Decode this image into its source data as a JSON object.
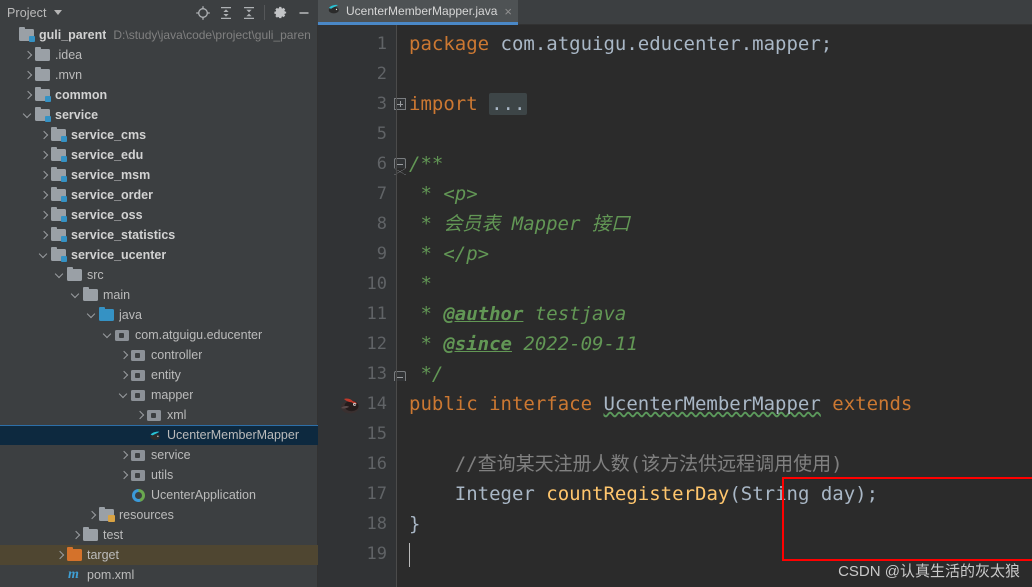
{
  "toolwindow": {
    "title": "Project",
    "dropdown_icon": "chevron-down-icon",
    "actions": [
      {
        "name": "locate-icon",
        "label": "Select Opened File"
      },
      {
        "name": "expand-all-icon",
        "label": "Expand All"
      },
      {
        "name": "collapse-all-icon",
        "label": "Collapse All"
      },
      {
        "name": "gear-icon",
        "label": "Settings"
      },
      {
        "name": "minimize-icon",
        "label": "Hide"
      }
    ]
  },
  "tabs": [
    {
      "label": "UcenterMemberMapper.java",
      "icon": "java-interface-icon",
      "close": "×",
      "active": true
    }
  ],
  "tree": [
    {
      "label": "guli_parent",
      "path": "D:\\study\\java\\code\\project\\guli_paren",
      "indent": 0,
      "arrow": "none",
      "icon": "module-folder-icon",
      "bold": true,
      "state": "normal"
    },
    {
      "label": ".idea",
      "path": "",
      "indent": 1,
      "arrow": "closed",
      "icon": "folder-icon",
      "bold": false,
      "state": "normal"
    },
    {
      "label": ".mvn",
      "path": "",
      "indent": 1,
      "arrow": "closed",
      "icon": "folder-icon",
      "bold": false,
      "state": "normal"
    },
    {
      "label": "common",
      "path": "",
      "indent": 1,
      "arrow": "closed",
      "icon": "module-folder-icon",
      "bold": true,
      "state": "normal"
    },
    {
      "label": "service",
      "path": "",
      "indent": 1,
      "arrow": "open",
      "icon": "module-folder-icon",
      "bold": true,
      "state": "normal"
    },
    {
      "label": "service_cms",
      "path": "",
      "indent": 2,
      "arrow": "closed",
      "icon": "module-folder-icon",
      "bold": true,
      "state": "normal"
    },
    {
      "label": "service_edu",
      "path": "",
      "indent": 2,
      "arrow": "closed",
      "icon": "module-folder-icon",
      "bold": true,
      "state": "normal"
    },
    {
      "label": "service_msm",
      "path": "",
      "indent": 2,
      "arrow": "closed",
      "icon": "module-folder-icon",
      "bold": true,
      "state": "normal"
    },
    {
      "label": "service_order",
      "path": "",
      "indent": 2,
      "arrow": "closed",
      "icon": "module-folder-icon",
      "bold": true,
      "state": "normal"
    },
    {
      "label": "service_oss",
      "path": "",
      "indent": 2,
      "arrow": "closed",
      "icon": "module-folder-icon",
      "bold": true,
      "state": "normal"
    },
    {
      "label": "service_statistics",
      "path": "",
      "indent": 2,
      "arrow": "closed",
      "icon": "module-folder-icon",
      "bold": true,
      "state": "normal"
    },
    {
      "label": "service_ucenter",
      "path": "",
      "indent": 2,
      "arrow": "open",
      "icon": "module-folder-icon",
      "bold": true,
      "state": "normal"
    },
    {
      "label": "src",
      "path": "",
      "indent": 3,
      "arrow": "open",
      "icon": "folder-icon",
      "bold": false,
      "state": "normal"
    },
    {
      "label": "main",
      "path": "",
      "indent": 4,
      "arrow": "open",
      "icon": "folder-icon",
      "bold": false,
      "state": "normal"
    },
    {
      "label": "java",
      "path": "",
      "indent": 5,
      "arrow": "open",
      "icon": "source-folder-icon",
      "bold": false,
      "state": "normal"
    },
    {
      "label": "com.atguigu.educenter",
      "path": "",
      "indent": 6,
      "arrow": "open",
      "icon": "package-icon",
      "bold": false,
      "state": "normal"
    },
    {
      "label": "controller",
      "path": "",
      "indent": 7,
      "arrow": "closed",
      "icon": "package-icon",
      "bold": false,
      "state": "normal"
    },
    {
      "label": "entity",
      "path": "",
      "indent": 7,
      "arrow": "closed",
      "icon": "package-icon",
      "bold": false,
      "state": "normal"
    },
    {
      "label": "mapper",
      "path": "",
      "indent": 7,
      "arrow": "open",
      "icon": "package-icon",
      "bold": false,
      "state": "normal"
    },
    {
      "label": "xml",
      "path": "",
      "indent": 8,
      "arrow": "closed",
      "icon": "package-icon",
      "bold": false,
      "state": "normal"
    },
    {
      "label": "UcenterMemberMapper",
      "path": "",
      "indent": 8,
      "arrow": "none",
      "icon": "java-interface-icon",
      "bold": false,
      "state": "selected"
    },
    {
      "label": "service",
      "path": "",
      "indent": 7,
      "arrow": "closed",
      "icon": "package-icon",
      "bold": false,
      "state": "normal"
    },
    {
      "label": "utils",
      "path": "",
      "indent": 7,
      "arrow": "closed",
      "icon": "package-icon",
      "bold": false,
      "state": "normal"
    },
    {
      "label": "UcenterApplication",
      "path": "",
      "indent": 7,
      "arrow": "none",
      "icon": "spring-boot-icon",
      "bold": false,
      "state": "normal"
    },
    {
      "label": "resources",
      "path": "",
      "indent": 5,
      "arrow": "closed",
      "icon": "resources-folder-icon",
      "bold": false,
      "state": "normal"
    },
    {
      "label": "test",
      "path": "",
      "indent": 4,
      "arrow": "closed",
      "icon": "folder-icon",
      "bold": false,
      "state": "normal"
    },
    {
      "label": "target",
      "path": "",
      "indent": 3,
      "arrow": "closed",
      "icon": "target-folder-icon",
      "bold": false,
      "state": "excluded"
    },
    {
      "label": "pom.xml",
      "path": "",
      "indent": 3,
      "arrow": "none",
      "icon": "maven-icon",
      "bold": false,
      "state": "normal"
    }
  ],
  "editor": {
    "line_numbers": [
      "1",
      "2",
      "3",
      "5",
      "6",
      "7",
      "8",
      "9",
      "10",
      "11",
      "12",
      "13",
      "14",
      "15",
      "16",
      "17",
      "18",
      "19"
    ],
    "lines": [
      {
        "n": "1",
        "tokens": [
          {
            "t": "package",
            "c": "k"
          },
          {
            "t": " com.atguigu.educenter.mapper;",
            "c": "id"
          }
        ]
      },
      {
        "n": "2",
        "tokens": []
      },
      {
        "n": "3",
        "fold": "plus",
        "tokens": [
          {
            "t": "import",
            "c": "k"
          },
          {
            "t": " ",
            "c": "id"
          },
          {
            "t": "...",
            "c": "fold-placeholder"
          }
        ]
      },
      {
        "n": "5",
        "tokens": []
      },
      {
        "n": "6",
        "fold": "comment-top",
        "tokens": [
          {
            "t": "/**",
            "c": "cm"
          }
        ]
      },
      {
        "n": "7",
        "tokens": [
          {
            "t": " * <p>",
            "c": "cm"
          }
        ]
      },
      {
        "n": "8",
        "tokens": [
          {
            "t": " * 会员表 Mapper 接口",
            "c": "cm"
          }
        ]
      },
      {
        "n": "9",
        "tokens": [
          {
            "t": " * </p>",
            "c": "cm"
          }
        ]
      },
      {
        "n": "10",
        "tokens": [
          {
            "t": " *",
            "c": "cm"
          }
        ]
      },
      {
        "n": "11",
        "tokens": [
          {
            "t": " * ",
            "c": "cm"
          },
          {
            "t": "@author",
            "c": "cmtag"
          },
          {
            "t": " testjava",
            "c": "cm"
          }
        ]
      },
      {
        "n": "12",
        "tokens": [
          {
            "t": " * ",
            "c": "cm"
          },
          {
            "t": "@since",
            "c": "cmtag"
          },
          {
            "t": " 2022-09-11",
            "c": "cm"
          }
        ]
      },
      {
        "n": "13",
        "fold": "comment-bottom",
        "tokens": [
          {
            "t": " */",
            "c": "cm"
          }
        ]
      },
      {
        "n": "14",
        "gutter_icon": "mybatis-bird-icon",
        "tokens": [
          {
            "t": "public interface ",
            "c": "k"
          },
          {
            "t": "UcenterMemberMapper",
            "c": "squig"
          },
          {
            "t": " extends",
            "c": "k"
          }
        ]
      },
      {
        "n": "15",
        "tokens": []
      },
      {
        "n": "16",
        "tokens": [
          {
            "t": "    //查询某天注册人数(该方法供远程调用使用)",
            "c": "lcm"
          }
        ]
      },
      {
        "n": "17",
        "tokens": [
          {
            "t": "    ",
            "c": "id"
          },
          {
            "t": "Integer",
            "c": "id"
          },
          {
            "t": " ",
            "c": "id"
          },
          {
            "t": "countRegisterDay",
            "c": "mth"
          },
          {
            "t": "(",
            "c": "id"
          },
          {
            "t": "String",
            "c": "id"
          },
          {
            "t": " day);",
            "c": "id"
          }
        ]
      },
      {
        "n": "18",
        "tokens": [
          {
            "t": "}",
            "c": "id"
          }
        ]
      },
      {
        "n": "19",
        "tokens": []
      }
    ],
    "highlight_box": {
      "color": "#ff0000",
      "label": "red-annotation-box"
    }
  },
  "watermark": "CSDN @认真生活的灰太狼",
  "colors": {
    "background": "#3c3f41",
    "editor_background": "#2b2b2b",
    "gutter_background": "#313335",
    "keyword": "#cc7832",
    "identifier": "#a9b7c6",
    "comment": "#629755",
    "line_comment": "#808080",
    "method": "#ffc66d",
    "selection": "#0d293f",
    "excluded_row": "#4f4631",
    "tab_underline": "#4a88c7",
    "annotation_box": "#ff0000"
  }
}
